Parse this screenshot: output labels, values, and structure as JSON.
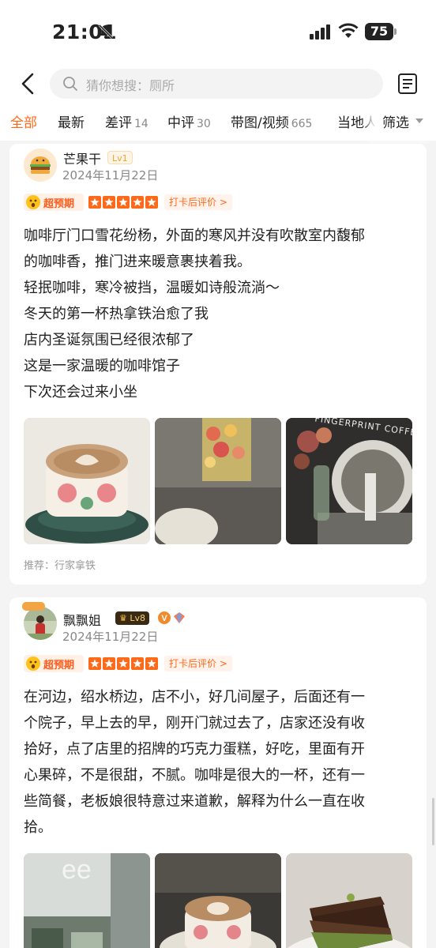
{
  "status": {
    "time": "21:01",
    "battery": "75"
  },
  "search": {
    "placeholder": "猜你想搜：厕所"
  },
  "tabs": [
    {
      "label": "全部",
      "count": ""
    },
    {
      "label": "最新",
      "count": ""
    },
    {
      "label": "差评",
      "count": "14"
    },
    {
      "label": "中评",
      "count": "30"
    },
    {
      "label": "带图/视频",
      "count": "665"
    },
    {
      "label": "当地人",
      "count": ""
    }
  ],
  "filter_label": "筛选",
  "reviews": [
    {
      "username": "芒果干",
      "level": "Lv1",
      "date": "2024年11月22日",
      "expectation_label": "超预期",
      "rating": 5,
      "checkin_label": "打卡后评价 >",
      "text_lines": [
        "咖啡厅门口雪花纷杨，外面的寒风并没有吹散室内馥郁",
        "的咖啡香，推门进来暖意裹挟着我。",
        "轻抿咖啡，寒冷被挡，温暖如诗般流淌～",
        "冬天的第一杯热拿铁治愈了我",
        "店内圣诞氛围已经很浓郁了",
        "这是一家温暖的咖啡馆子",
        "下次还会过来小坐"
      ],
      "photos": [
        "latte-art-cup",
        "flower-painting-wall",
        "fingerprint-coffee-storefront"
      ],
      "photo_sign_text": "FINGERPRINT COFFEE",
      "recommend": "推荐：行家拿铁"
    },
    {
      "username": "飘飘姐",
      "level": "Lv8",
      "date": "2024年11月22日",
      "expectation_label": "超预期",
      "rating": 5,
      "checkin_label": "打卡后评价 >",
      "text_lines": [
        "在河边，绍水桥边，店不小，好几间屋子，后面还有一",
        "个院子，早上去的早，刚开门就过去了，店家还没有收",
        "拾好，点了店里的招牌的巧克力蛋糕，好吃，里面有开",
        "心果碎，不是很甜，不腻。咖啡是很大的一杯，还有一",
        "些简餐，老板娘很特意过来道歉，解释为什么一直在收",
        "拾。"
      ],
      "photos": [
        "street-storefront",
        "latte-cup-on-table",
        "chocolate-pistachio-cake"
      ],
      "photo_sign_text": "ee"
    }
  ],
  "colors": {
    "accent": "#ff6a1a",
    "background": "#f4f4f4"
  }
}
